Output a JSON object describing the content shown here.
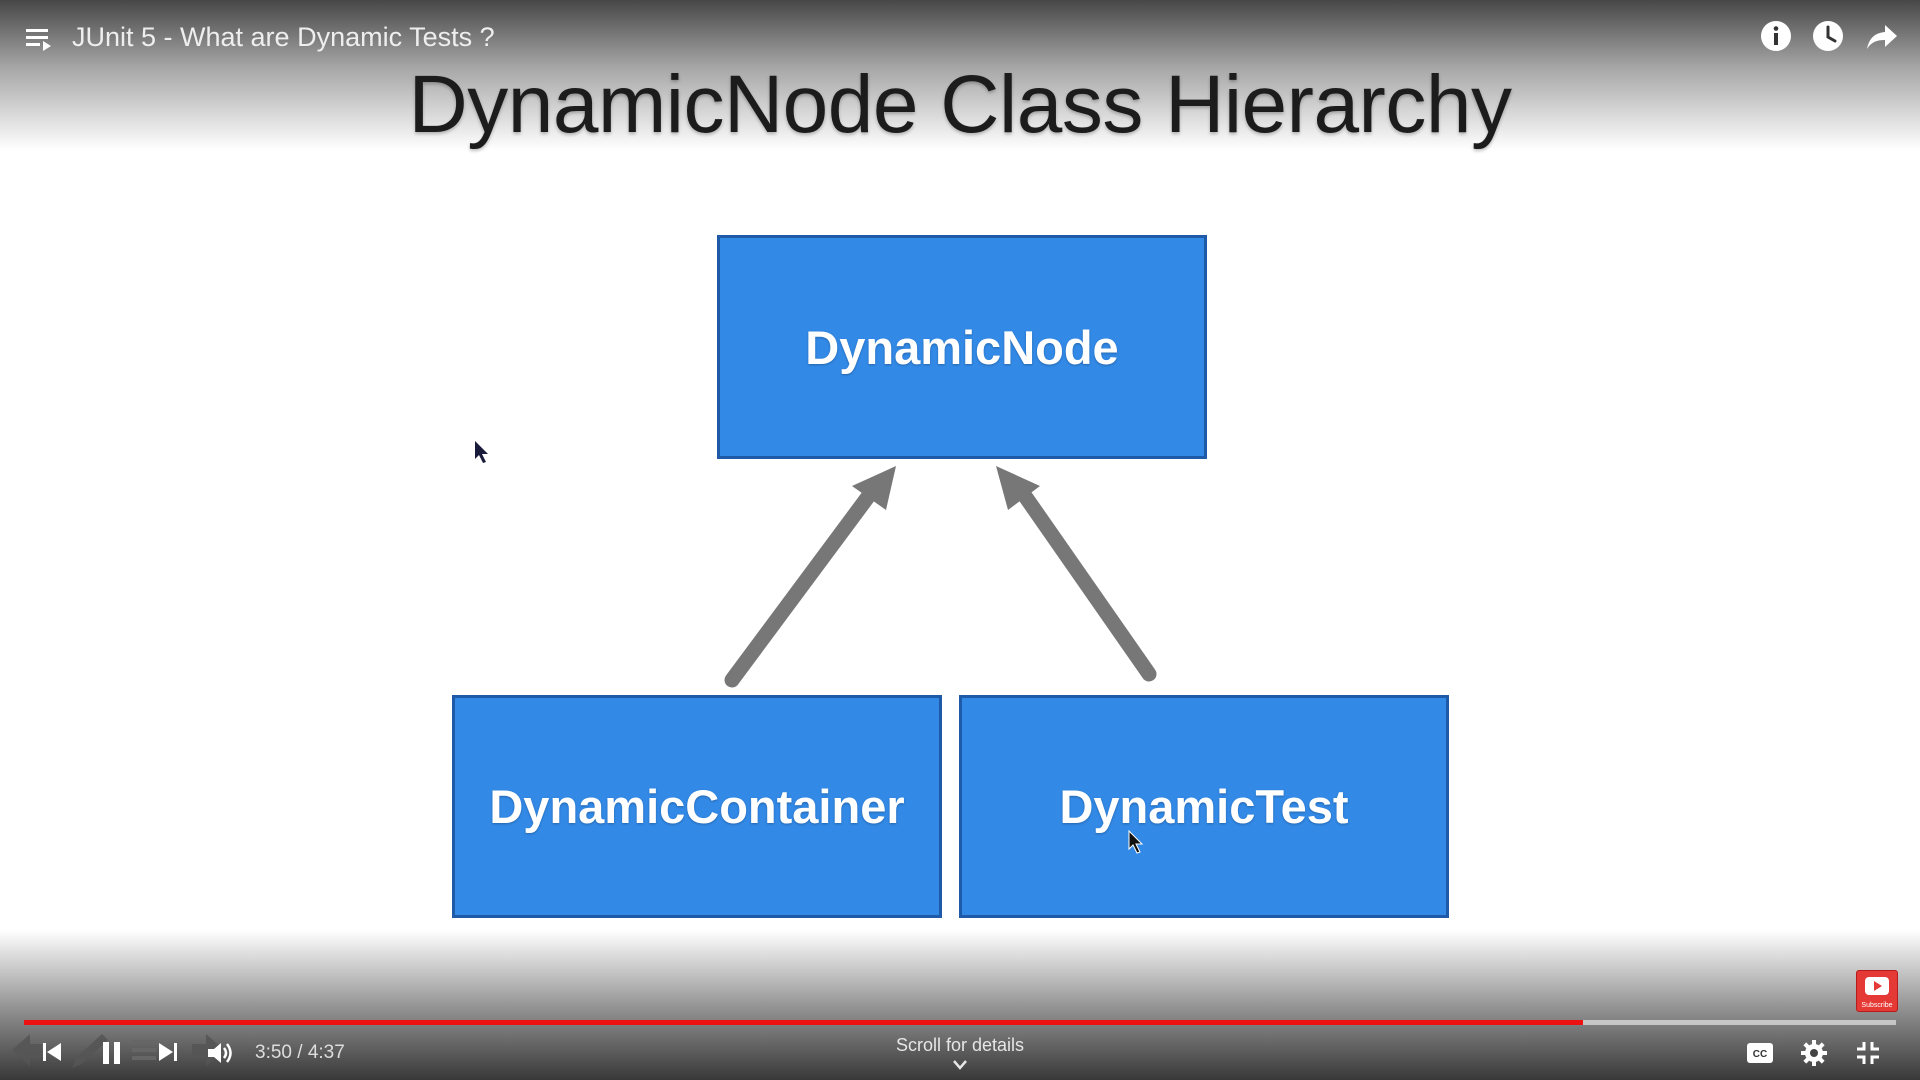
{
  "header": {
    "video_title": "JUnit 5 - What are Dynamic Tests ?",
    "icons": [
      "playlist-icon",
      "info-icon",
      "watch-later-icon",
      "share-icon"
    ]
  },
  "slide": {
    "title": "DynamicNode Class Hierarchy",
    "nodes": {
      "parent": "DynamicNode",
      "child_left": "DynamicContainer",
      "child_right": "DynamicTest"
    },
    "colors": {
      "node_fill": "#3289e6",
      "node_border": "#1f5aa8",
      "arrow": "#777777"
    }
  },
  "subscribe": {
    "label": "Subscribe"
  },
  "player": {
    "progress_fraction": 0.833,
    "elapsed": "3:50",
    "duration": "4:37",
    "time_text": "3:50 / 4:37",
    "scroll_label": "Scroll for details",
    "colors": {
      "progress": "#ee1111"
    },
    "icons": [
      "back-icon",
      "skip-previous-icon",
      "pencil-icon",
      "pause-icon",
      "queue-icon",
      "skip-next-icon",
      "forward-icon",
      "volume-icon",
      "captions-icon",
      "settings-icon",
      "exit-fullscreen-icon"
    ]
  }
}
